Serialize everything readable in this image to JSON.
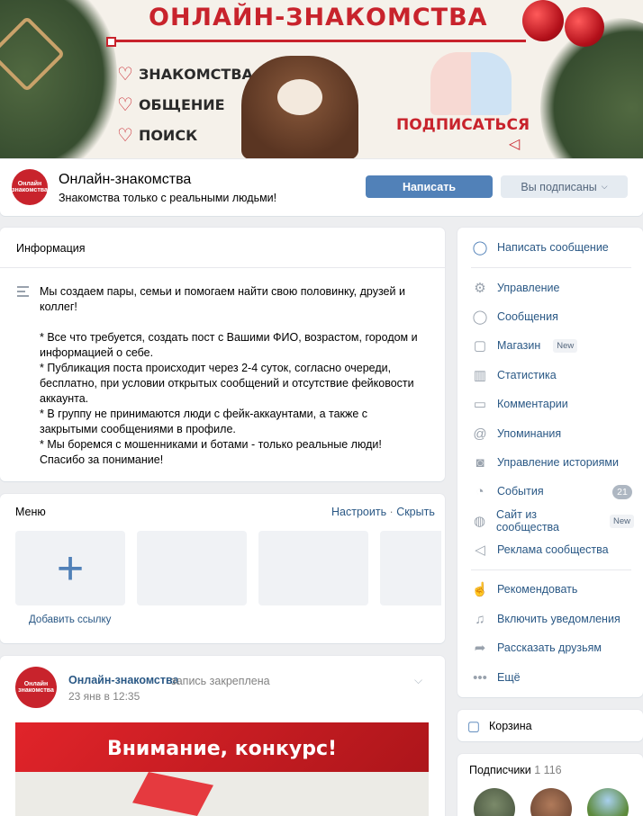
{
  "cover": {
    "title": "ОНЛАЙН-ЗНАКОМСТВА",
    "features": [
      "ЗНАКОМСТВА",
      "ОБЩЕНИЕ",
      "ПОИСК"
    ],
    "subscribe": "ПОДПИСАТЬСЯ"
  },
  "header": {
    "name": "Онлайн-знакомства",
    "status": "Знакомства только с реальными людьми!",
    "write_button": "Написать",
    "subscribed_button": "Вы подписаны",
    "avatar_text": "Онлайн знакомства"
  },
  "info": {
    "title": "Информация",
    "text": "Мы создаем пары, семьи и помогаем найти свою половинку, друзей и коллег!\n\n* Все что требуется, создать пост с Вашими ФИО, возрастом, городом и информацией о себе.\n* Публикация поста происходит через 2-4 суток, согласно очереди, бесплатно, при условии открытых сообщений и отсутствие фейковости аккаунта.\n* В группу не принимаются люди с фейк-аккаунтами, а также с закрытыми сообщениями в профиле.\n* Мы боремся с мошенниками и ботами - только реальные люди!\nСпасибо за понимание!"
  },
  "menu": {
    "title": "Меню",
    "configure": "Настроить",
    "separator": " · ",
    "hide": "Скрыть",
    "add_link": "Добавить ссылку"
  },
  "post": {
    "author": "Онлайн-знакомства",
    "pinned": "запись закреплена",
    "date": "23 янв в 12:35",
    "image_title": "Внимание, конкурс!"
  },
  "nav": {
    "write_message": "Написать сообщение",
    "management": "Управление",
    "messages": "Сообщения",
    "shop": "Магазин",
    "shop_badge": "New",
    "stats": "Статистика",
    "comments": "Комментарии",
    "mentions": "Упоминания",
    "stories": "Управление историями",
    "events": "События",
    "events_count": "21",
    "site": "Сайт из сообщества",
    "site_badge": "New",
    "ads": "Реклама сообщества",
    "recommend": "Рекомендовать",
    "notifications": "Включить уведомления",
    "tell_friends": "Рассказать друзьям",
    "more": "Ещё"
  },
  "cart": {
    "label": "Корзина"
  },
  "subscribers": {
    "title": "Подписчики",
    "count": "1 116"
  },
  "colors": {
    "accent": "#5181b8",
    "brand_red": "#c8232c",
    "link": "#2a5885"
  }
}
